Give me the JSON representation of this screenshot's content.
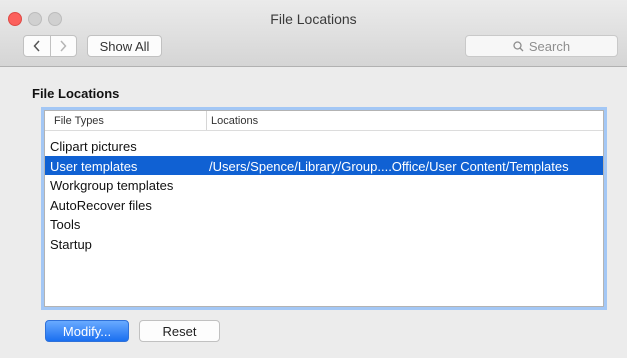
{
  "window": {
    "title": "File Locations"
  },
  "toolbar": {
    "show_all_label": "Show All",
    "search_placeholder": "Search"
  },
  "section": {
    "title": "File Locations"
  },
  "table": {
    "columns": [
      "File Types",
      "Locations"
    ],
    "rows": [
      {
        "type": "Clipart pictures",
        "location": ""
      },
      {
        "type": "User templates",
        "location": "/Users/Spence/Library/Group....Office/User Content/Templates",
        "selected": true
      },
      {
        "type": "Workgroup templates",
        "location": ""
      },
      {
        "type": "AutoRecover files",
        "location": ""
      },
      {
        "type": "Tools",
        "location": ""
      },
      {
        "type": "Startup",
        "location": ""
      }
    ]
  },
  "buttons": {
    "modify_label": "Modify...",
    "reset_label": "Reset"
  },
  "colors": {
    "selection": "#1061d3",
    "focus_ring": "#a3c7f5",
    "close": "#fc605c"
  },
  "icons": [
    "close-icon",
    "minimize-icon",
    "zoom-icon",
    "chevron-left-icon",
    "chevron-right-icon",
    "search-icon"
  ]
}
